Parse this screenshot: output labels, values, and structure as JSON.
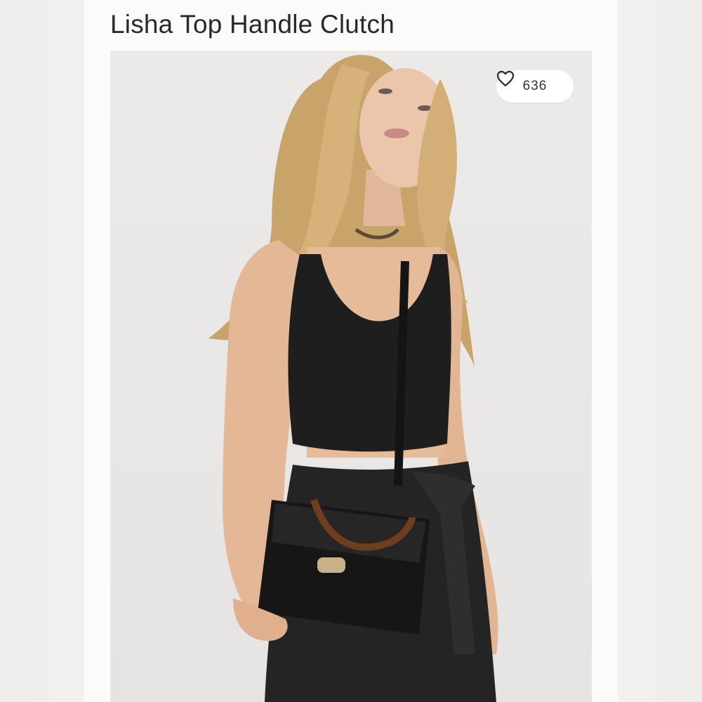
{
  "product": {
    "title": "Lisha Top Handle Clutch"
  },
  "likes": {
    "count": "636",
    "icon": "heart-outline-icon"
  },
  "image": {
    "icon": "product-photo"
  },
  "colors": {
    "page_background": "#f1efed",
    "card_background": "#fcfbfa",
    "photo_background": "#eceae8",
    "text": "#2a2a2a"
  }
}
